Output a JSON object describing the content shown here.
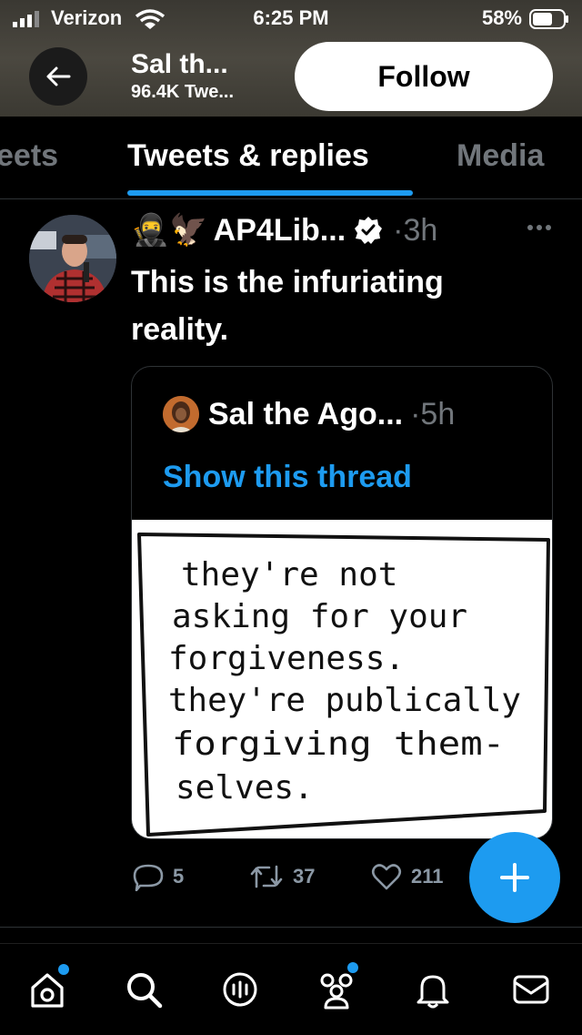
{
  "status_bar": {
    "carrier": "Verizon",
    "time": "6:25 PM",
    "battery": "58%"
  },
  "profile_header": {
    "name": "Sal th...",
    "tweet_count": "96.4K Twe...",
    "follow_label": "Follow",
    "back_icon": "arrow-left-icon"
  },
  "tabs": [
    {
      "label": "eets",
      "active": false
    },
    {
      "label": "Tweets & replies",
      "active": true
    },
    {
      "label": "Media",
      "active": false
    }
  ],
  "tweet": {
    "author_emojis": "🥷🦅",
    "author_name": "AP4Lib...",
    "verified": true,
    "time": "3h",
    "text": "This is the infuriating reality.",
    "quote": {
      "author_name": "Sal the Ago...",
      "time": "5h",
      "show_thread_label": "Show this thread",
      "image_text": [
        "they're not",
        "asking for your",
        "forgiveness.",
        "they're publically",
        "forgiving them-",
        "selves."
      ]
    },
    "counts": {
      "replies": "5",
      "retweets": "37",
      "likes": "211"
    }
  },
  "colors": {
    "accent": "#1d9bf0",
    "muted": "#71767b",
    "background": "#000000"
  },
  "bottom_nav": [
    {
      "icon": "home-icon",
      "badge": true
    },
    {
      "icon": "search-icon",
      "badge": false
    },
    {
      "icon": "spaces-icon",
      "badge": false
    },
    {
      "icon": "communities-icon",
      "badge": true
    },
    {
      "icon": "notifications-icon",
      "badge": false
    },
    {
      "icon": "messages-icon",
      "badge": false
    }
  ],
  "fab_icon": "plus-icon"
}
